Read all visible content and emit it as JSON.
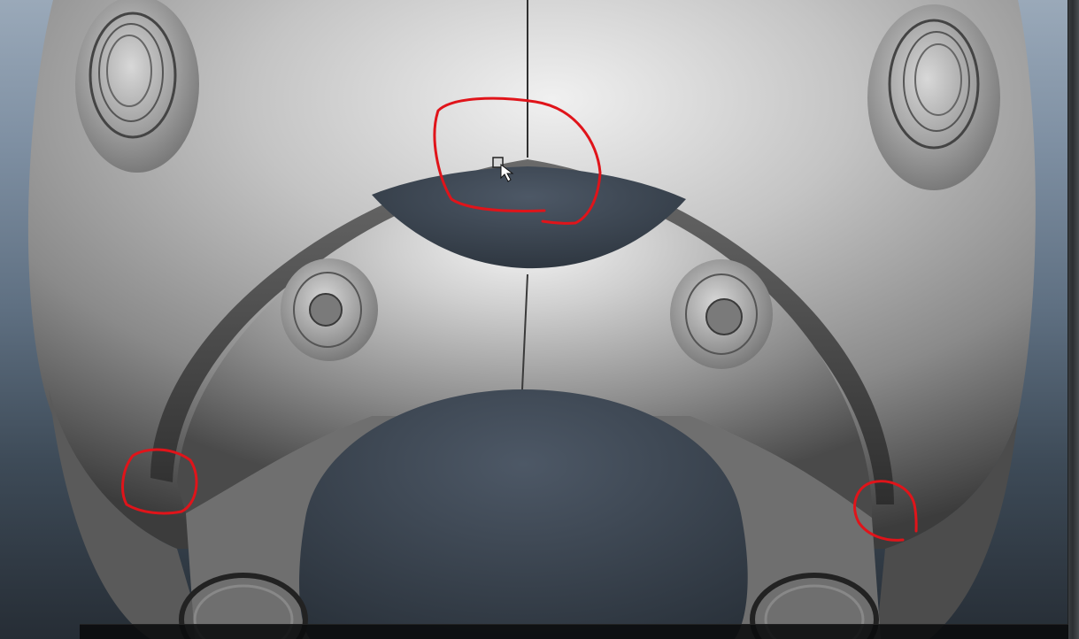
{
  "viewport": {
    "background_top": "#9aa9b9",
    "background_bottom": "#262d35"
  },
  "model": {
    "surface_color": "#b8b8b8",
    "highlight_color": "#f2f2f2",
    "shadow_color": "#3a3a3a"
  },
  "annotations": {
    "stroke_color": "#e0141a",
    "items": [
      {
        "name": "top-seam-circle"
      },
      {
        "name": "left-corner-circle"
      },
      {
        "name": "right-corner-circle"
      }
    ]
  },
  "cursor": {
    "icon": "arrow-select-cursor-icon"
  },
  "help_line": {
    "text": ""
  }
}
